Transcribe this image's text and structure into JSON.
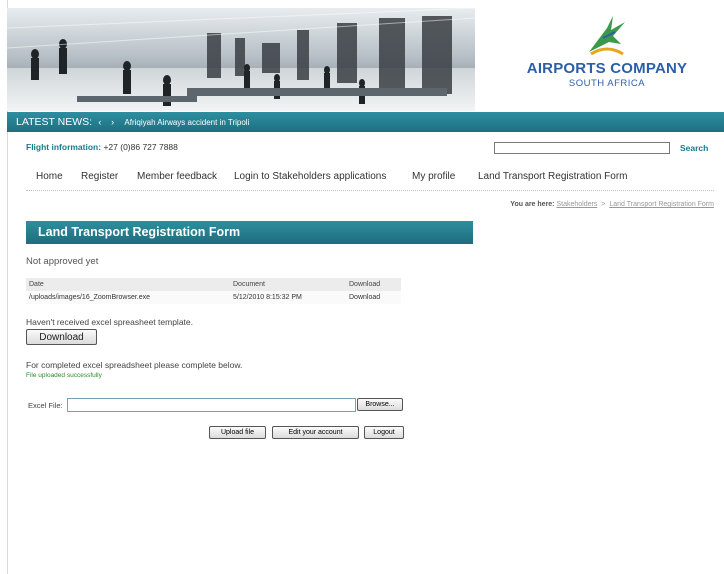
{
  "header": {
    "logo_line1": "AIRPORTS COMPANY",
    "logo_line2": "SOUTH AFRICA"
  },
  "news": {
    "label": "LATEST NEWS:",
    "prev_icon": "‹",
    "next_icon": "›",
    "headline": "Afriqiyah Airways accident in Tripoli"
  },
  "flight_info": {
    "label": "Flight information:",
    "phone": "+27 (0)86 727 7888"
  },
  "search": {
    "value": "",
    "button_label": "Search"
  },
  "nav": {
    "items": [
      {
        "label": "Home"
      },
      {
        "label": "Register"
      },
      {
        "label": "Member feedback"
      },
      {
        "label": "Login to Stakeholders applications"
      },
      {
        "label": "My profile"
      },
      {
        "label": "Land Transport Registration Form"
      }
    ]
  },
  "breadcrumb": {
    "prefix": "You are here:",
    "items": [
      "Stakeholders",
      "Land Transport Registration Form"
    ],
    "separator": ">"
  },
  "page": {
    "title": "Land Transport Registration Form",
    "status": "Not approved yet"
  },
  "table": {
    "headers": [
      "Date",
      "Document",
      "Download"
    ],
    "rows": [
      [
        "/uploads/images/16_ZoomBrowser.exe",
        "5/12/2010 8:15:32 PM",
        "Download"
      ]
    ]
  },
  "template_note": "Haven't received excel spreasheet template.",
  "download_button": "Download",
  "completed_note": "For completed excel spreadsheet please complete below.",
  "upload_status": "File uploaded successfully",
  "excel_file": {
    "label": "Excel File:",
    "value": "",
    "browse_label": "Browse..."
  },
  "actions": {
    "upload": "Upload file",
    "edit": "Edit your account",
    "logout": "Logout"
  },
  "colors": {
    "teal": "#1d6f80",
    "logo_blue": "#2d5ea8",
    "success_green": "#2e8b2e"
  }
}
